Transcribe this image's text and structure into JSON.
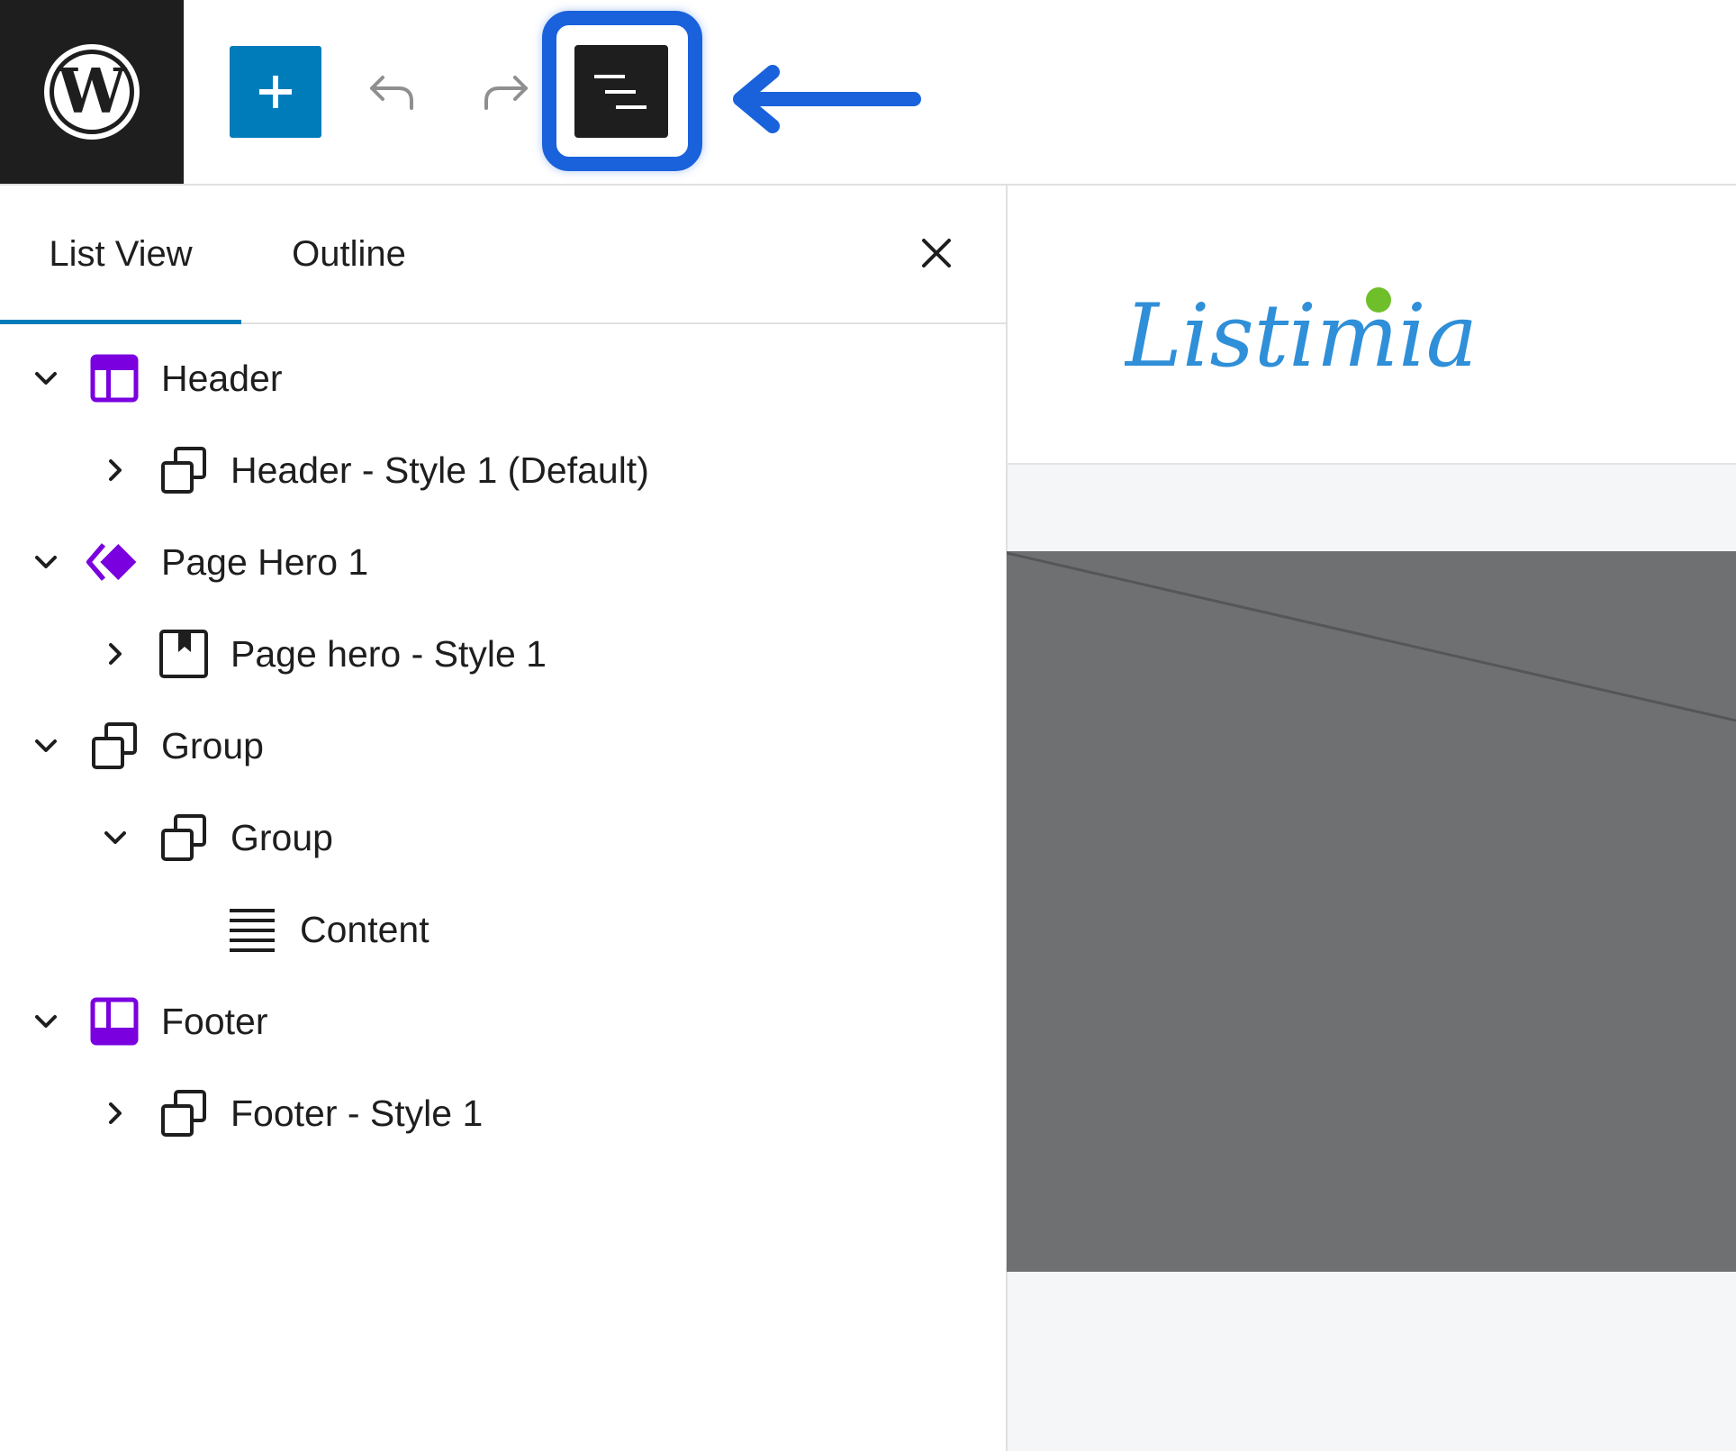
{
  "toolbar": {
    "logo_icon": "wordpress-logo-icon",
    "add_icon": "plus-icon",
    "undo_icon": "undo-icon",
    "redo_icon": "redo-icon",
    "list_view_icon": "list-view-icon",
    "highlight_color": "#1a62dc",
    "accent": "#007cba"
  },
  "panel": {
    "tabs": [
      {
        "label": "List View",
        "active": true
      },
      {
        "label": "Outline",
        "active": false
      }
    ],
    "close_icon": "close-icon"
  },
  "tree": [
    {
      "label": "Header",
      "icon": "template-part-header-icon",
      "expanded": true,
      "level": 1
    },
    {
      "label": "Header - Style 1 (Default)",
      "icon": "group-icon",
      "expanded": false,
      "level": 2
    },
    {
      "label": "Page Hero 1",
      "icon": "synced-pattern-icon",
      "expanded": true,
      "level": 1
    },
    {
      "label": "Page hero - Style 1",
      "icon": "cover-icon",
      "expanded": false,
      "level": 2
    },
    {
      "label": "Group",
      "icon": "group-icon",
      "expanded": true,
      "level": 1
    },
    {
      "label": "Group",
      "icon": "group-icon",
      "expanded": true,
      "level": 2
    },
    {
      "label": "Content",
      "icon": "post-content-icon",
      "expanded": null,
      "level": 3
    },
    {
      "label": "Footer",
      "icon": "template-part-footer-icon",
      "expanded": true,
      "level": 1
    },
    {
      "label": "Footer - Style 1",
      "icon": "group-icon",
      "expanded": false,
      "level": 2
    }
  ],
  "canvas": {
    "brand_name": "Listimia",
    "brand_color": "#2f8fd8",
    "brand_dot_color": "#6fbf2a",
    "hero_color": "#6f7071"
  }
}
